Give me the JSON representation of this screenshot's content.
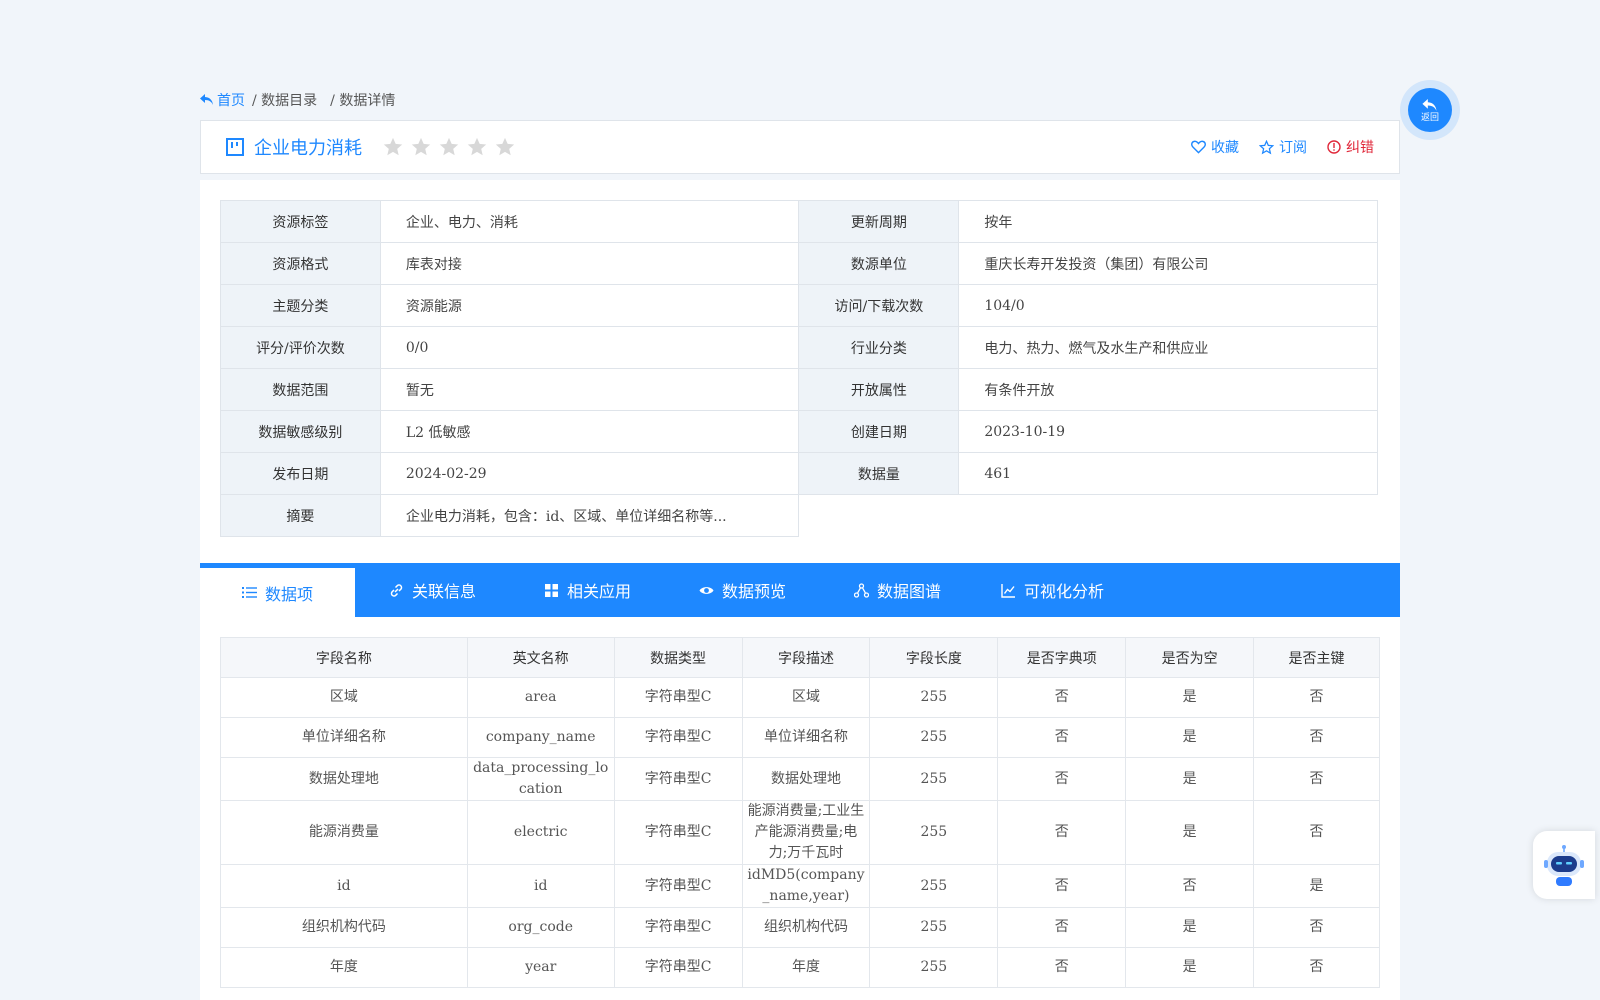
{
  "breadcrumb": {
    "home": "首页",
    "items": [
      "/ 数据目录",
      "/ 数据详情"
    ]
  },
  "title": "企业电力消耗",
  "rating": {
    "stars_filled": 0,
    "stars_total": 5
  },
  "actions": {
    "collect": "收藏",
    "subscribe": "订阅",
    "report": "纠错"
  },
  "info": {
    "rows": [
      {
        "k1": "资源标签",
        "v1": "企业、电力、消耗",
        "k2": "更新周期",
        "v2": "按年"
      },
      {
        "k1": "资源格式",
        "v1": "库表对接",
        "k2": "数源单位",
        "v2": "重庆长寿开发投资（集团）有限公司"
      },
      {
        "k1": "主题分类",
        "v1": "资源能源",
        "k2": "访问/下载次数",
        "v2": "104/0"
      },
      {
        "k1": "评分/评价次数",
        "v1": "0/0",
        "k2": "行业分类",
        "v2": "电力、热力、燃气及水生产和供应业"
      },
      {
        "k1": "数据范围",
        "v1": "暂无",
        "k2": "开放属性",
        "v2": "有条件开放"
      },
      {
        "k1": "数据敏感级别",
        "v1": "L2 低敏感",
        "k2": "创建日期",
        "v2": "2023-10-19"
      },
      {
        "k1": "发布日期",
        "v1": "2024-02-29",
        "k2": "数据量",
        "v2": "461"
      },
      {
        "k1": "摘要",
        "v1": "企业电力消耗，包含：id、区域、单位详细名称等..."
      }
    ]
  },
  "tabs": [
    {
      "label": "数据项",
      "icon": "list-icon"
    },
    {
      "label": "关联信息",
      "icon": "link-icon"
    },
    {
      "label": "相关应用",
      "icon": "grid-icon"
    },
    {
      "label": "数据预览",
      "icon": "eye-icon"
    },
    {
      "label": "数据图谱",
      "icon": "graph-icon"
    },
    {
      "label": "可视化分析",
      "icon": "chart-icon"
    }
  ],
  "fields": {
    "headers": [
      "字段名称",
      "英文名称",
      "数据类型",
      "字段描述",
      "字段长度",
      "是否字典项",
      "是否为空",
      "是否主键"
    ],
    "rows": [
      [
        "区域",
        "area",
        "字符串型C",
        "区域",
        "255",
        "否",
        "是",
        "否"
      ],
      [
        "单位详细名称",
        "company_name",
        "字符串型C",
        "单位详细名称",
        "255",
        "否",
        "是",
        "否"
      ],
      [
        "数据处理地",
        "data_processing_location",
        "字符串型C",
        "数据处理地",
        "255",
        "否",
        "是",
        "否"
      ],
      [
        "能源消费量",
        "electric",
        "字符串型C",
        "能源消费量;工业生产能源消费量;电力;万千瓦时",
        "255",
        "否",
        "是",
        "否"
      ],
      [
        "id",
        "id",
        "字符串型C",
        "idMD5(company_name,year)",
        "255",
        "否",
        "否",
        "是"
      ],
      [
        "组织机构代码",
        "org_code",
        "字符串型C",
        "组织机构代码",
        "255",
        "否",
        "是",
        "否"
      ],
      [
        "年度",
        "year",
        "字符串型C",
        "年度",
        "255",
        "否",
        "是",
        "否"
      ]
    ]
  },
  "back_button": "返回",
  "colors": {
    "primary": "#1e88ff",
    "error": "#e0283a",
    "star": "#d8d8d8"
  }
}
